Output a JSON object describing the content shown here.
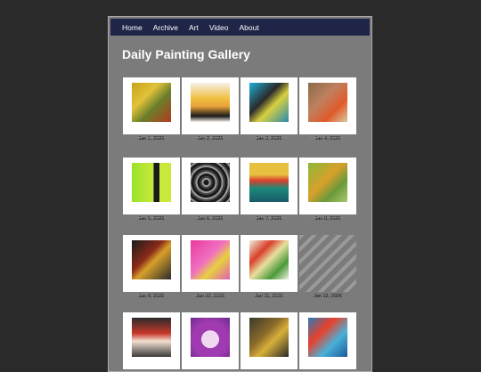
{
  "nav": {
    "items": [
      "Home",
      "Archive",
      "Art",
      "Video",
      "About"
    ]
  },
  "title": "Daily Painting Gallery",
  "gallery": {
    "items": [
      {
        "date": "Jan 1, 2026"
      },
      {
        "date": "Jan 2, 2026"
      },
      {
        "date": "Jan 3, 2026"
      },
      {
        "date": "Jan 4, 2026"
      },
      {
        "date": "Jan 5, 2026"
      },
      {
        "date": "Jan 6, 2026"
      },
      {
        "date": "Jan 7, 2026"
      },
      {
        "date": "Jan 8, 2026"
      },
      {
        "date": "Jan 9, 2026"
      },
      {
        "date": "Jan 10, 2026"
      },
      {
        "date": "Jan 11, 2026"
      },
      {
        "date": "Jan 12, 2026"
      },
      {
        "date": ""
      },
      {
        "date": ""
      },
      {
        "date": ""
      },
      {
        "date": ""
      }
    ]
  }
}
